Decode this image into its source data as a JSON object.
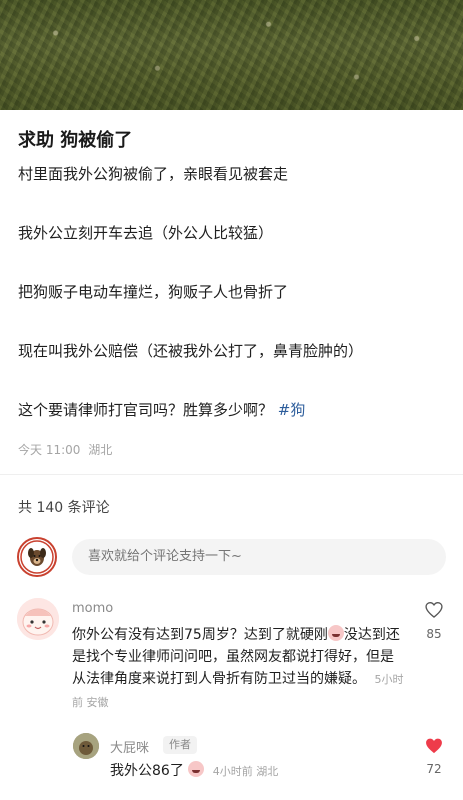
{
  "post": {
    "title": "求助 狗被偷了",
    "paragraphs": [
      "村里面我外公狗被偷了，亲眼看见被套走",
      "我外公立刻开车去追（外公人比较猛）",
      "把狗贩子电动车撞烂，狗贩子人也骨折了",
      "现在叫我外公赔偿（还被我外公打了，鼻青脸肿的）",
      "这个要请律师打官司吗？胜算多少啊？"
    ],
    "hashtag": "#狗",
    "time": "今天 11:00",
    "location": "湖北"
  },
  "comments_header": {
    "count_label": "共 140 条评论"
  },
  "comment_box": {
    "placeholder": "喜欢就给个评论支持一下~"
  },
  "comments": [
    {
      "author": "momo",
      "text_part1": "你外公有没有达到75周岁？达到了就硬刚",
      "text_part2": "没达到还是找个专业律师问问吧，虽然网友都说打得好，但是从法律角度来说打到人骨折有防卫过当的嫌疑。",
      "time": "5小时前",
      "location": "安徽",
      "likes": "85",
      "liked": false
    }
  ],
  "reply": {
    "author": "大屁咪",
    "badge": "作者",
    "text": "我外公86了",
    "time": "4小时前",
    "location": "湖北",
    "likes": "72",
    "liked": true
  },
  "colors": {
    "like_active": "#ee3b4a",
    "hashtag": "#2e5e9c"
  }
}
